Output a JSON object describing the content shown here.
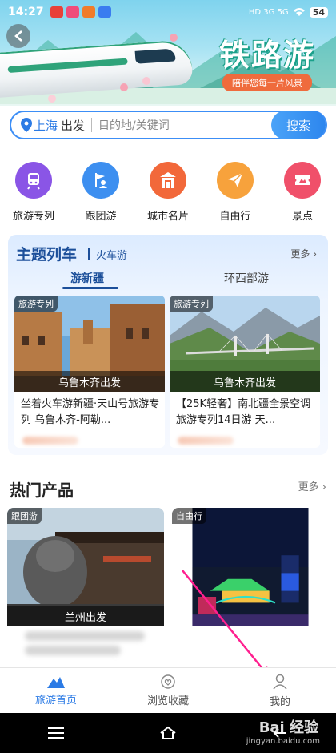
{
  "status_bar": {
    "time": "14:27",
    "network": "HD 3G 5G",
    "battery": "54"
  },
  "banner": {
    "title": "铁路游",
    "subtitle": "陪伴您每一片风景"
  },
  "search": {
    "city": "上海",
    "depart_label": "出发",
    "placeholder": "目的地/关键词",
    "button_label": "搜索"
  },
  "quick_nav": [
    {
      "label": "旅游专列",
      "icon": "train-icon",
      "color": "#8a55e6"
    },
    {
      "label": "跟团游",
      "icon": "group-flag-icon",
      "color": "#3d8ff0"
    },
    {
      "label": "城市名片",
      "icon": "city-gate-icon",
      "color": "#f2683a"
    },
    {
      "label": "自由行",
      "icon": "paper-plane-icon",
      "color": "#f7a23c"
    },
    {
      "label": "景点",
      "icon": "ticket-icon",
      "color": "#f0506a"
    }
  ],
  "theme_trains": {
    "title": "主题列车",
    "subtitle": "火车游",
    "more": "更多",
    "tabs": [
      "游新疆",
      "环西部游"
    ],
    "active_tab": 0,
    "cards": [
      {
        "tag": "旅游专列",
        "departure": "乌鲁木齐出发",
        "title": "坐着火车游新疆·天山号旅游专列 乌鲁木齐-阿勒..."
      },
      {
        "tag": "旅游专列",
        "departure": "乌鲁木齐出发",
        "title": "【25K轻奢】南北疆全景空调旅游专列14日游 天..."
      }
    ]
  },
  "hot_products": {
    "title": "热门产品",
    "more": "更多",
    "cards": [
      {
        "tag": "跟团游",
        "departure": "兰州出发"
      },
      {
        "tag": "自由行",
        "departure": ""
      }
    ]
  },
  "tab_bar": [
    {
      "label": "旅游首页",
      "icon": "home-mountain-icon",
      "active": true
    },
    {
      "label": "浏览收藏",
      "icon": "heart-icon",
      "active": false
    },
    {
      "label": "我的",
      "icon": "user-icon",
      "active": false
    }
  ],
  "watermark": {
    "brand": "Bai 经验",
    "url": "jingyan.baidu.com"
  },
  "colors": {
    "accent": "#2c7be5",
    "theme_title": "#1c4f9a"
  }
}
